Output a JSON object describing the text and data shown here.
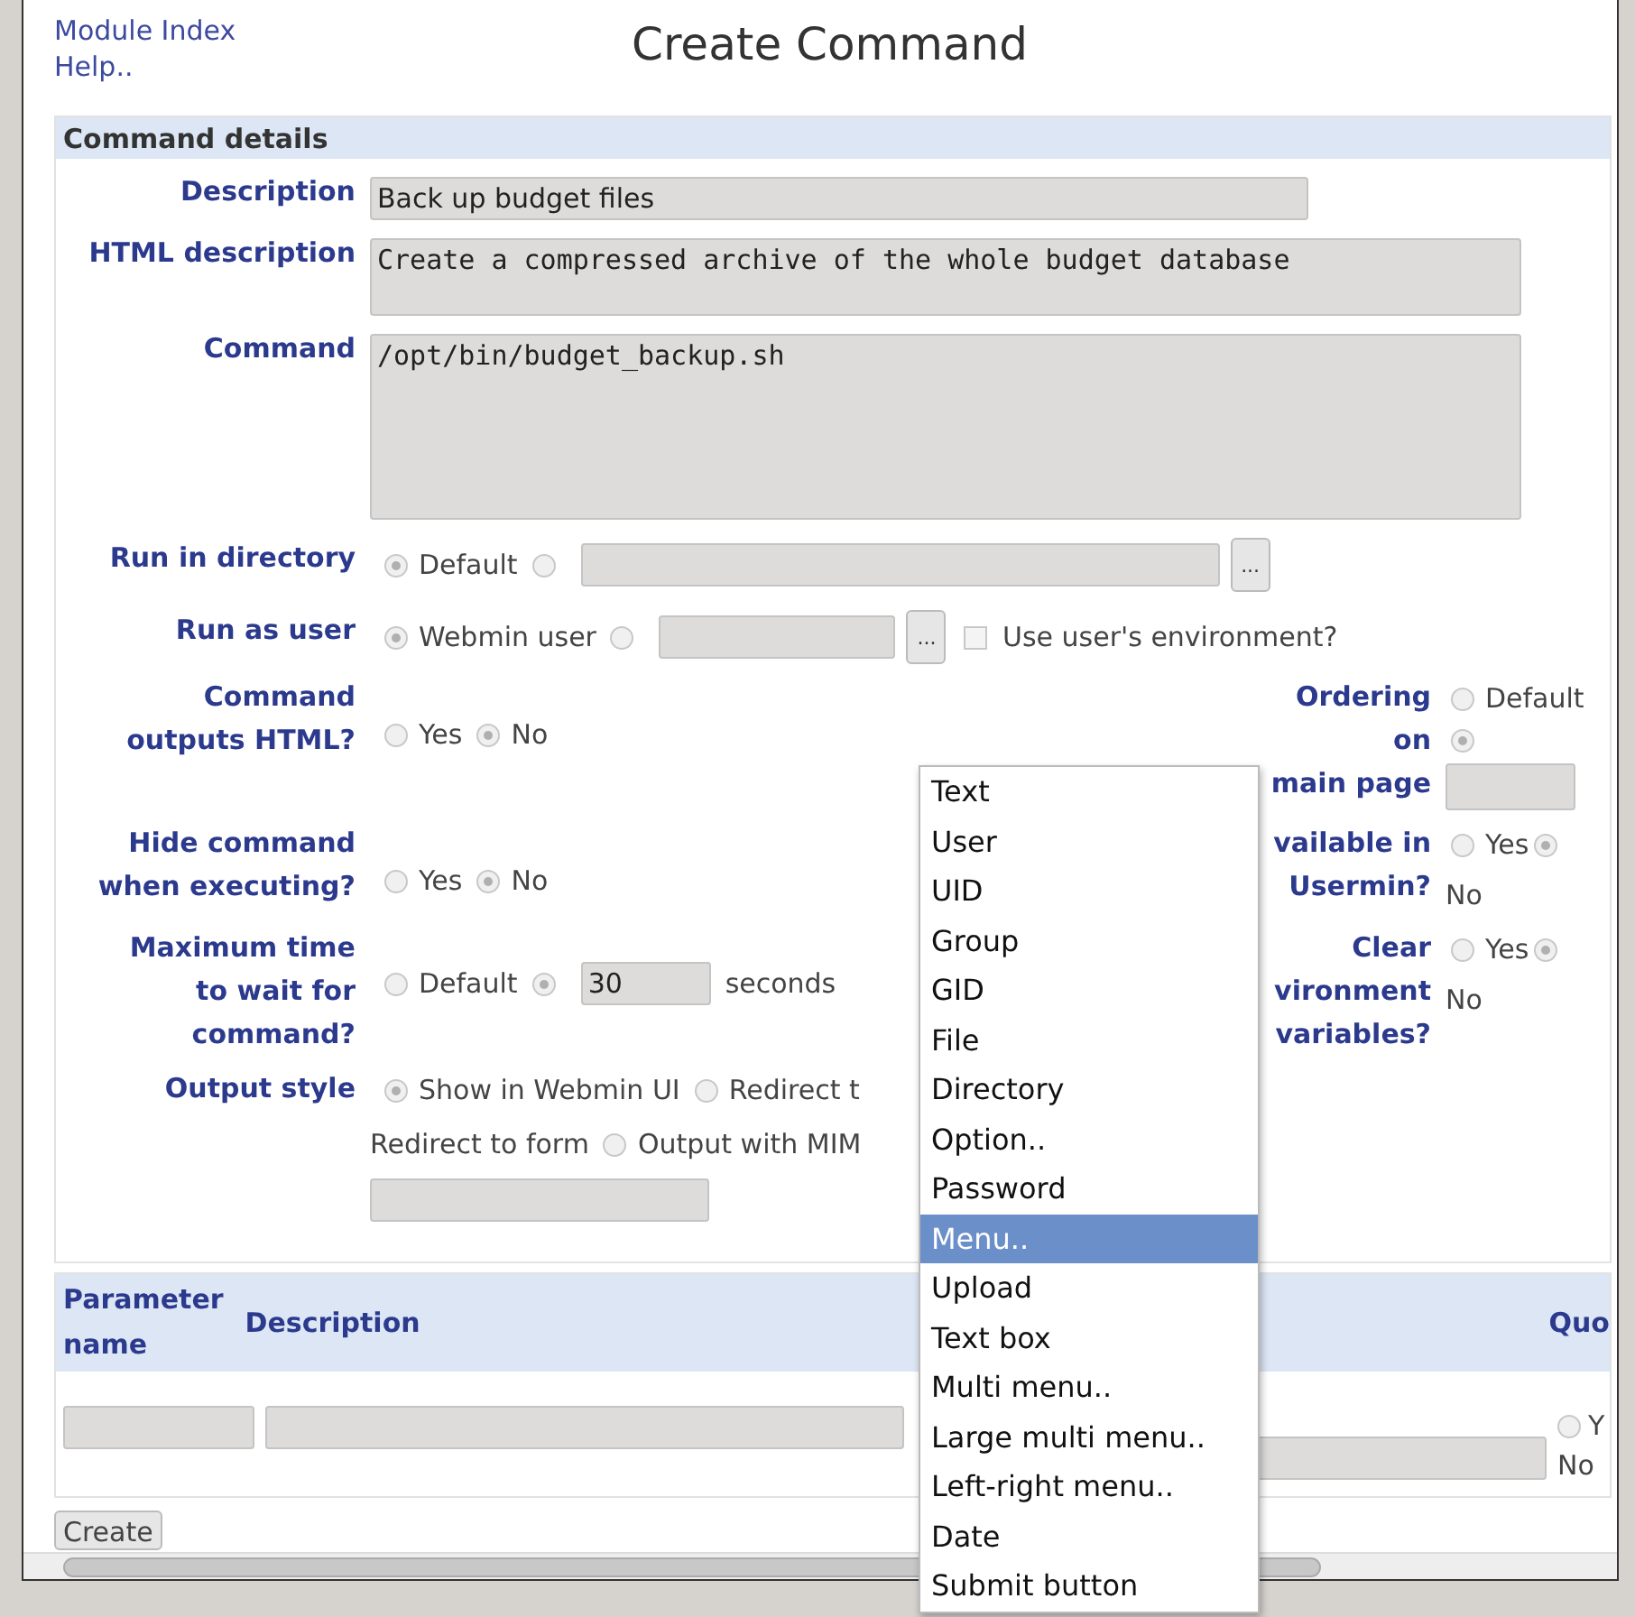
{
  "nav_links": [
    "Module Index",
    "Help.."
  ],
  "title": "Create Command",
  "section": {
    "title": "Command details",
    "rows": [
      {
        "label": "Description",
        "controls": [
          {
            "kind": "field",
            "value": "Back up budget files"
          }
        ]
      },
      {
        "label": "HTML description",
        "controls": [
          {
            "kind": "textarea",
            "value": "Create a compressed archive of the whole budget database"
          }
        ]
      },
      {
        "label": "Command",
        "controls": [
          {
            "kind": "textarea",
            "value": "/opt/bin/budget_backup.sh"
          }
        ]
      },
      {
        "label": "Run in directory",
        "controls": [
          {
            "kind": "radio",
            "label": "Default",
            "selected": true
          },
          {
            "kind": "radio",
            "selected": false
          },
          {
            "kind": "field"
          },
          {
            "kind": "button",
            "label": "..."
          }
        ]
      },
      {
        "label": "Run as user",
        "controls": [
          {
            "kind": "radio",
            "label": "Webmin user",
            "selected": true
          },
          {
            "kind": "radio",
            "selected": false
          },
          {
            "kind": "field"
          },
          {
            "kind": "button",
            "label": "..."
          },
          {
            "kind": "checkbox",
            "label": "Use user's environment?",
            "checked": false
          }
        ]
      },
      {
        "label": "Command\noutputs HTML?",
        "controls": [
          {
            "kind": "radio",
            "label": "Yes",
            "selected": false
          },
          {
            "kind": "radio",
            "label": "No",
            "selected": true
          }
        ],
        "side": {
          "label": "Ordering on\nmain page",
          "controls": [
            {
              "kind": "radio",
              "label": "Default",
              "selected": false
            },
            {
              "kind": "radio",
              "selected": true
            },
            {
              "kind": "field"
            }
          ]
        }
      },
      {
        "label": "Hide command\nwhen executing?",
        "controls": [
          {
            "kind": "radio",
            "label": "Yes",
            "selected": false
          },
          {
            "kind": "radio",
            "label": "No",
            "selected": true
          }
        ],
        "side": {
          "label": "vailable in\nUsermin?",
          "controls": [
            {
              "kind": "radio",
              "label": "Yes",
              "selected": false
            },
            {
              "kind": "radio",
              "label": "No",
              "selected": true
            }
          ]
        }
      },
      {
        "label": "Maximum time\nto wait for\ncommand?",
        "controls": [
          {
            "kind": "radio",
            "label": "Default",
            "selected": false
          },
          {
            "kind": "radio",
            "selected": true
          },
          {
            "kind": "field",
            "value": "30"
          },
          {
            "kind": "text",
            "text": "seconds"
          }
        ],
        "side": {
          "label": "Clear\nvironment\nvariables?",
          "controls": [
            {
              "kind": "radio",
              "label": "Yes",
              "selected": false
            },
            {
              "kind": "radio",
              "label": "No",
              "selected": true
            }
          ]
        }
      },
      {
        "label": "Output style",
        "controls": [
          {
            "kind": "radio",
            "label": "Show in Webmin UI",
            "selected": true
          },
          {
            "kind": "radio",
            "label": "Redirect t",
            "selected": false
          },
          {
            "kind": "break"
          },
          {
            "kind": "text",
            "text": "Redirect to form"
          },
          {
            "kind": "radio",
            "label": "Output with MIM",
            "selected": false
          },
          {
            "kind": "break"
          },
          {
            "kind": "field"
          }
        ]
      }
    ]
  },
  "parameters": {
    "columns": [
      "Parameter\nname",
      "Description",
      "Quo"
    ],
    "row": {
      "options": [
        {
          "label": "Y",
          "selected": false
        },
        {
          "label": "No"
        }
      ]
    }
  },
  "create_button": "Create",
  "dropdown": [
    {
      "label": "Text",
      "selected": false
    },
    {
      "label": "User",
      "selected": false
    },
    {
      "label": "UID",
      "selected": false
    },
    {
      "label": "Group",
      "selected": false
    },
    {
      "label": "GID",
      "selected": false
    },
    {
      "label": "File",
      "selected": false
    },
    {
      "label": "Directory",
      "selected": false
    },
    {
      "label": "Option..",
      "selected": false
    },
    {
      "label": "Password",
      "selected": false
    },
    {
      "label": "Menu..",
      "selected": true
    },
    {
      "label": "Upload",
      "selected": false
    },
    {
      "label": "Text box",
      "selected": false
    },
    {
      "label": "Multi menu..",
      "selected": false
    },
    {
      "label": "Large multi menu..",
      "selected": false
    },
    {
      "label": "Left-right menu..",
      "selected": false
    },
    {
      "label": "Date",
      "selected": false
    },
    {
      "label": "Submit button",
      "selected": false
    }
  ]
}
